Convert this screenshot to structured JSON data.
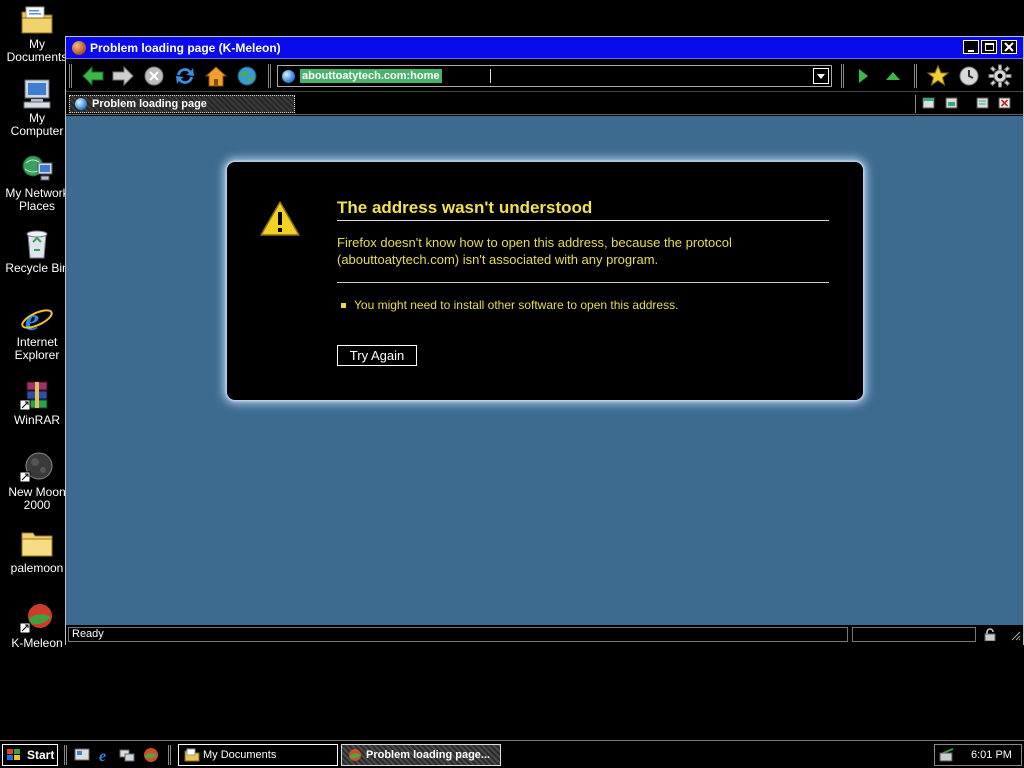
{
  "desktop": {
    "icons": [
      {
        "label_1": "My",
        "label_2": "Documents",
        "icon": "folder-documents-icon"
      },
      {
        "label_1": "My",
        "label_2": "Computer",
        "icon": "computer-icon"
      },
      {
        "label_1": "My Network",
        "label_2": "Places",
        "icon": "network-places-icon"
      },
      {
        "label_1": "Recycle Bin",
        "label_2": "",
        "icon": "recycle-bin-icon"
      },
      {
        "label_1": "Internet",
        "label_2": "Explorer",
        "icon": "internet-explorer-icon"
      },
      {
        "label_1": "WinRAR",
        "label_2": "",
        "icon": "winrar-icon"
      },
      {
        "label_1": "New Moon",
        "label_2": "2000",
        "icon": "new-moon-icon"
      },
      {
        "label_1": "palemoon",
        "label_2": "",
        "icon": "folder-icon"
      },
      {
        "label_1": "K-Meleon",
        "label_2": "",
        "icon": "k-meleon-icon"
      }
    ]
  },
  "window": {
    "title": "Problem loading page (K-Meleon)"
  },
  "toolbar": {
    "url": "abouttoatytech.com:home",
    "buttons": [
      "back-icon",
      "forward-icon",
      "stop-icon",
      "reload-icon",
      "home-icon",
      "go-globe-icon",
      "go-icon",
      "up-icon",
      "bookmarks-star-icon",
      "history-clock-icon",
      "settings-gear-icon"
    ]
  },
  "tabs": [
    {
      "label": "Problem loading page"
    }
  ],
  "error": {
    "title": "The address wasn't understood",
    "description": "Firefox doesn't know how to open this address, because the protocol (abouttoatytech.com) isn't associated with any program.",
    "hint": "You might need to install other software to open this address.",
    "button": "Try Again"
  },
  "statusbar": {
    "text": "Ready"
  },
  "taskbar": {
    "start": "Start",
    "tasks": [
      {
        "label": "My Documents"
      },
      {
        "label": "Problem loading page..."
      }
    ],
    "clock": "6:01 PM"
  },
  "colors": {
    "titlebar": "#0a0aee",
    "content_bg": "#3d6a8f",
    "error_title": "#f3e24a",
    "error_text": "#e8dc4e",
    "url_highlight": "#49b36a"
  }
}
